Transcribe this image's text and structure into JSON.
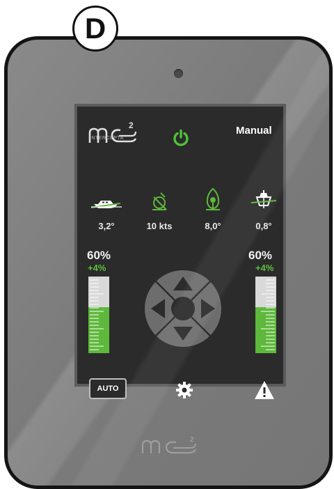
{
  "figure_label": "D",
  "brand": {
    "subtitle": "INTERCEPTA"
  },
  "header": {
    "mode": "Manual"
  },
  "sensors": [
    {
      "icon": "trim-boat-side-icon",
      "value": "3,2°"
    },
    {
      "icon": "speed-gauge-icon",
      "value": "10 kts"
    },
    {
      "icon": "pitch-icon",
      "value": "8,0°"
    },
    {
      "icon": "roll-boat-front-icon",
      "value": "0,8°"
    }
  ],
  "left_tab": {
    "percent": "60%",
    "delta": "+4%",
    "level": 0.6
  },
  "right_tab": {
    "percent": "60%",
    "delta": "+4%",
    "level": 0.6
  },
  "footer": {
    "auto_label": "AUTO"
  },
  "colors": {
    "accent_green": "#5eb83b",
    "screen_bg": "#2b2b2b",
    "device_bezel": "#141414"
  }
}
